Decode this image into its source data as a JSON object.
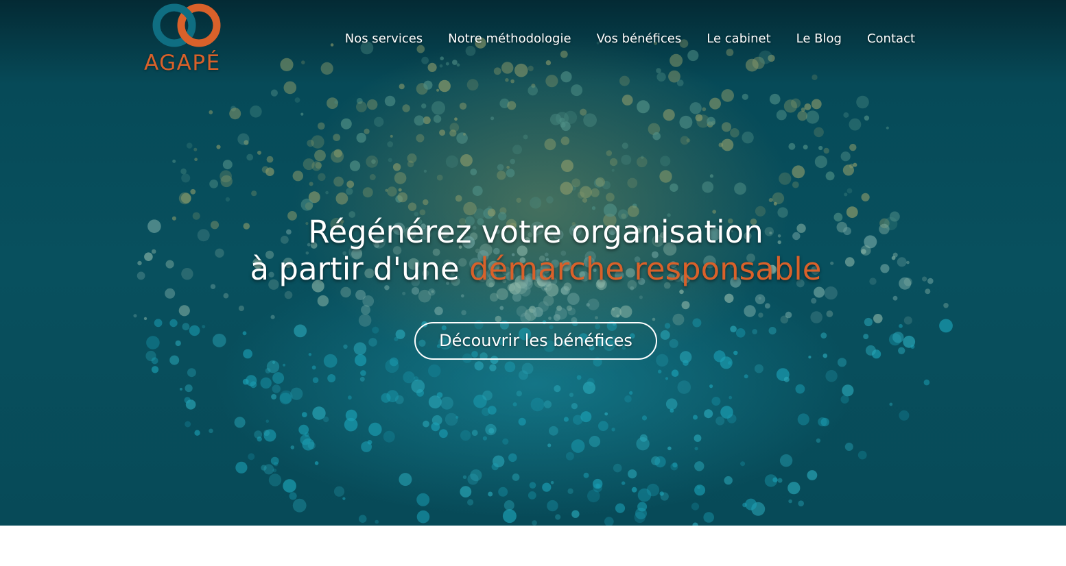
{
  "brand": {
    "logo_text": "AGAPÉ",
    "colors": {
      "teal": "#0f6e82",
      "orange": "#d9612a"
    }
  },
  "nav": {
    "items": [
      {
        "label": "Nos services"
      },
      {
        "label": "Notre méthodologie"
      },
      {
        "label": "Vos bénéfices"
      },
      {
        "label": "Le cabinet"
      },
      {
        "label": "Le Blog"
      },
      {
        "label": "Contact"
      }
    ]
  },
  "hero": {
    "headline_line1": "Régénérez votre organisation",
    "headline_line2_prefix": "à partir d'une ",
    "headline_line2_accent": "démarche responsable",
    "cta_label": "Découvrir les bénéfices",
    "accent_color": "#d9612a"
  }
}
